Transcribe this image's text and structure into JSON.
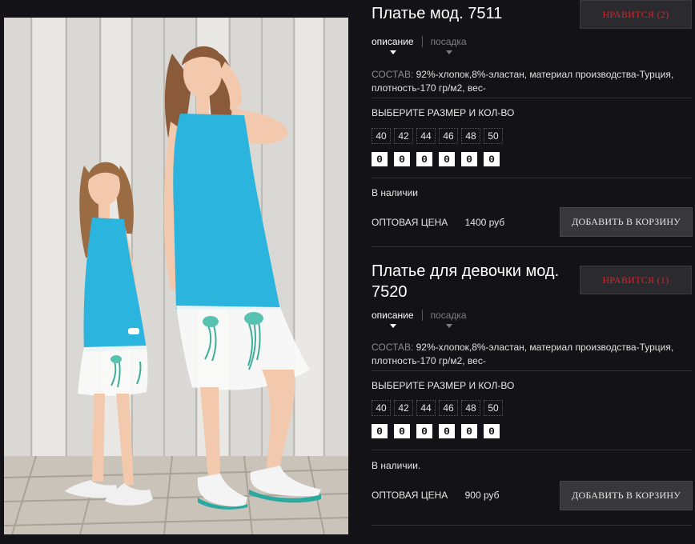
{
  "colors": {
    "background": "#131216",
    "like_text": "#d2262b",
    "button_bg": "#38373b",
    "dress": "#2bb4de"
  },
  "products": [
    {
      "title": "Платье мод. 7511",
      "like_label": "НРАВИТСЯ (2)",
      "tabs": [
        {
          "label": "описание",
          "active": true
        },
        {
          "label": "посадка",
          "active": false
        }
      ],
      "composition_key": "СОСТАВ:",
      "composition_value": "92%-хлопок,8%-эластан, материал производства-Турция, плотность-170 гр/м2, вес-",
      "choose_size_label": "ВЫБЕРИТЕ РАЗМЕР И КОЛ-ВО",
      "sizes": [
        "40",
        "42",
        "44",
        "46",
        "48",
        "50"
      ],
      "quantities": [
        "0",
        "0",
        "0",
        "0",
        "0",
        "0"
      ],
      "stock": "В наличии",
      "price_label": "ОПТОВАЯ ЦЕНА",
      "price_value": "1400 руб",
      "cart_label": "ДОБАВИТЬ В КОРЗИНУ"
    },
    {
      "title": "Платье для девочки мод. 7520",
      "like_label": "НРАВИТСЯ (1)",
      "tabs": [
        {
          "label": "описание",
          "active": true
        },
        {
          "label": "посадка",
          "active": false
        }
      ],
      "composition_key": "СОСТАВ:",
      "composition_value": "92%-хлопок,8%-эластан, материал производства-Турция, плотность-170 гр/м2, вес-",
      "choose_size_label": "ВЫБЕРИТЕ РАЗМЕР И КОЛ-ВО",
      "sizes": [
        "40",
        "42",
        "44",
        "46",
        "48",
        "50"
      ],
      "quantities": [
        "0",
        "0",
        "0",
        "0",
        "0",
        "0"
      ],
      "stock": "В наличии.",
      "price_label": "ОПТОВАЯ ЦЕНА",
      "price_value": "900 руб",
      "cart_label": "ДОБАВИТЬ В КОРЗИНУ"
    }
  ]
}
